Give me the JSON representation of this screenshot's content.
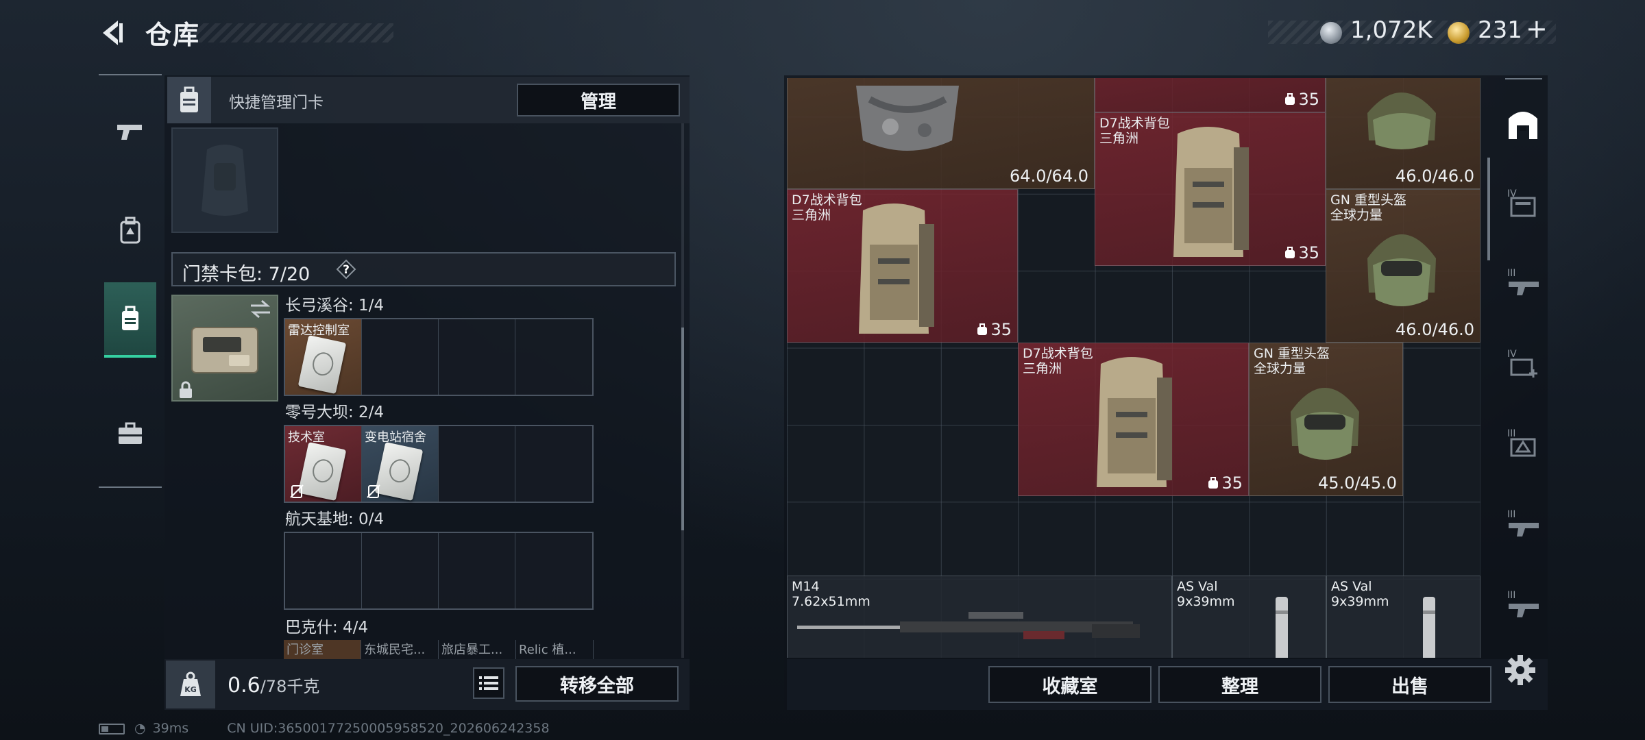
{
  "header": {
    "title": "仓库",
    "currency_silver": "1,072K",
    "currency_gold": "231",
    "currency_gold_add": "+"
  },
  "left_rail": {
    "tabs": [
      "pistol-icon",
      "backpack-tab-icon",
      "keycard-tab-icon",
      "toolbox-icon"
    ],
    "active_index": 2
  },
  "card_panel": {
    "quick_manage_label": "快捷管理门卡",
    "manage_button": "管理",
    "cardpack_label": "门禁卡包: 7/20",
    "help_symbol": "?",
    "maps": [
      {
        "title": "长弓溪谷: 1/4",
        "slots": [
          {
            "label": "雷达控制室",
            "color": "brown"
          },
          null,
          null,
          null
        ]
      },
      {
        "title": "零号大坝: 2/4",
        "slots": [
          {
            "label": "技术室",
            "color": "red",
            "unavailable": true
          },
          {
            "label": "变电站宿舍",
            "color": "blue",
            "unavailable": true
          },
          null,
          null
        ]
      },
      {
        "title": "航天基地: 0/4",
        "slots": [
          null,
          null,
          null,
          null
        ]
      },
      {
        "title": "巴克什: 4/4",
        "slots_preview": [
          "门诊室",
          "东城民宅...",
          "旅店暴工...",
          "Relic 植..."
        ]
      }
    ]
  },
  "bottom_bar": {
    "weight_value": "0.6",
    "weight_unit": "/78千克",
    "kg_badge": "KG",
    "transfer_all": "转移全部"
  },
  "status": {
    "ping": "39ms",
    "uid": "CN UID:36500177250005958520_202606242358"
  },
  "inventory": {
    "items": [
      {
        "id": "pouch-top",
        "name": "",
        "durability": "64.0/64.0",
        "color": "brown"
      },
      {
        "id": "bag-1",
        "name": "D7战术背包\n三角洲",
        "capacity": "35",
        "color": "red"
      },
      {
        "id": "bag-2",
        "name": "D7战术背包\n三角洲",
        "capacity": "35",
        "color": "red"
      },
      {
        "id": "bag-3",
        "name": "D7战术背包\n三角洲",
        "capacity": "35",
        "color": "red"
      },
      {
        "id": "bag-top",
        "name": "",
        "capacity": "35",
        "color": "red"
      },
      {
        "id": "helmet-top",
        "name": "",
        "durability": "46.0/46.0",
        "color": "brown"
      },
      {
        "id": "helmet-1",
        "name": "GN 重型头盔\n全球力量",
        "durability": "46.0/46.0",
        "color": "brown"
      },
      {
        "id": "helmet-2",
        "name": "GN 重型头盔\n全球力量",
        "durability": "45.0/45.0",
        "color": "brown"
      },
      {
        "id": "m14",
        "name": "M14\n7.62x51mm",
        "color": "dark"
      },
      {
        "id": "asval-1",
        "name": "AS Val\n9x39mm",
        "color": "dark"
      },
      {
        "id": "asval-2",
        "name": "AS Val\n9x39mm",
        "color": "dark"
      }
    ],
    "buttons": {
      "collection": "收藏室",
      "sort": "整理",
      "sell": "出售"
    }
  },
  "right_rail": {
    "tabs": [
      "home-base-icon",
      "tier-iv-storage-icon",
      "tier-iii-weapon-icon",
      "tier-iv-medical-icon",
      "tier-iii-armor-icon",
      "tier-iii-weapon-2-icon",
      "tier-iii-weapon-3-icon"
    ],
    "tier_labels": [
      "IV",
      "III",
      "IV",
      "III",
      "III",
      "III"
    ]
  },
  "colors": {
    "accent_green": "#35d0a1",
    "item_red": "#7a2630",
    "item_brown": "#543c2c"
  }
}
